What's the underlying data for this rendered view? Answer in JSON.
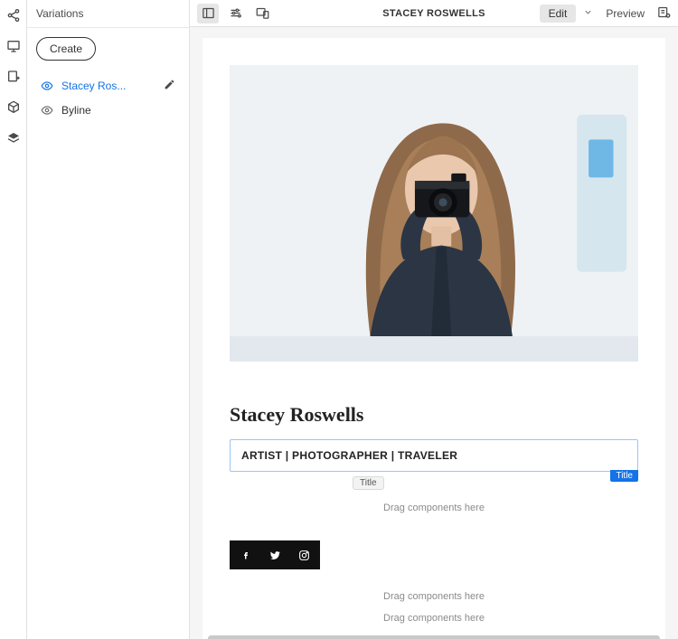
{
  "leftpanel": {
    "header": "Variations",
    "create_label": "Create",
    "items": [
      {
        "label": "Stacey Ros...",
        "selected": true,
        "editable": true
      },
      {
        "label": "Byline",
        "selected": false,
        "editable": false
      }
    ]
  },
  "toolbar": {
    "title": "STACEY ROSWELLS",
    "edit_label": "Edit",
    "preview_label": "Preview"
  },
  "content": {
    "heading": "Stacey Roswells",
    "title_component": {
      "text": "ARTIST | PHOTOGRAPHER | TRAVELER",
      "component_label": "Title",
      "chip_label": "Title"
    },
    "dropzones": {
      "d1": "Drag components here",
      "d2": "Drag components here",
      "d3": "Drag components here"
    }
  },
  "icons": {
    "rail": [
      "share-icon",
      "screen-icon",
      "page-add-icon",
      "cube-icon",
      "layers-icon"
    ],
    "social": [
      "facebook-icon",
      "twitter-icon",
      "instagram-icon"
    ]
  }
}
